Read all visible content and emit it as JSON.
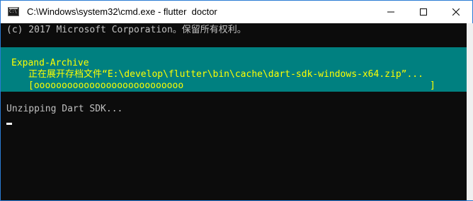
{
  "window": {
    "title": "C:\\Windows\\system32\\cmd.exe - flutter  doctor",
    "app_icon": "cmd-icon",
    "controls": {
      "minimize_icon": "minimize-icon",
      "maximize_icon": "maximize-icon",
      "close_icon": "close-icon"
    }
  },
  "console": {
    "copyright_line": "(c) 2017 Microsoft Corporation。保留所有权利。",
    "progress": {
      "activity": "Expand-Archive",
      "status": "正在展开存档文件“E:\\develop\\flutter\\bin\\cache\\dart-sdk-windows-x64.zip”...",
      "bar": "[ooooooooooooooooooooooooooo",
      "bar_end": "]"
    },
    "unzip_line": "Unzipping Dart SDK...",
    "colors": {
      "background": "#0c0c0c",
      "text": "#c0c0c0",
      "progress_background": "#008080",
      "progress_text": "#ffff00"
    }
  }
}
